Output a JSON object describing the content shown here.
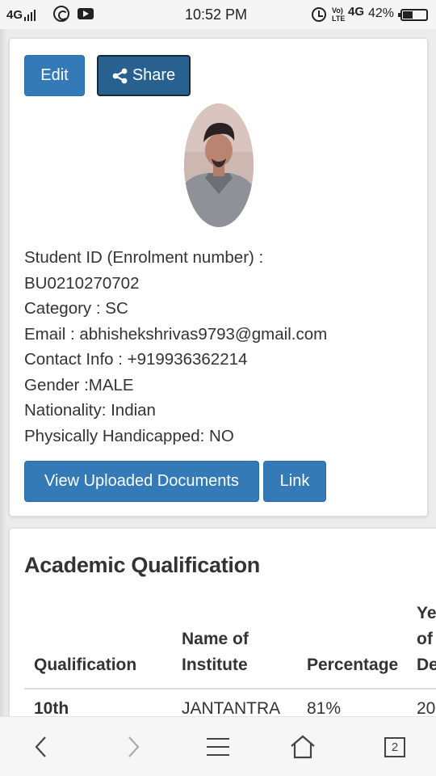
{
  "status_bar": {
    "network": "4G",
    "time": "10:52 PM",
    "volte": "Vo) LTE",
    "network2": "4G",
    "battery": "42%"
  },
  "profile": {
    "edit_label": "Edit",
    "share_label": "Share",
    "info_lines": [
      "Student ID (Enrolment number) :",
      "BU0210270702",
      "Category : SC",
      "Email : abhishekshrivas9793@gmail.com",
      "Contact Info : +919936362214",
      "Gender :MALE",
      "Nationality: Indian",
      "Physically Handicapped: NO"
    ],
    "docs_label": "View Uploaded Documents",
    "link_label": "Link"
  },
  "academic": {
    "title": "Academic Qualification",
    "headers": {
      "qualification": "Qualification",
      "institute_line1": "Name of",
      "institute_line2": "Institute",
      "percentage": "Percentage",
      "year_line1": "Ye",
      "year_line2": "of",
      "year_line3": "De"
    },
    "rows": [
      {
        "qualification": "10th",
        "institute": "JANTANTRA",
        "percentage": "81%",
        "year": "20"
      }
    ]
  },
  "nav": {
    "tab_count": "2"
  },
  "colors": {
    "primary": "#337ab7",
    "primary_dark": "#286090"
  }
}
